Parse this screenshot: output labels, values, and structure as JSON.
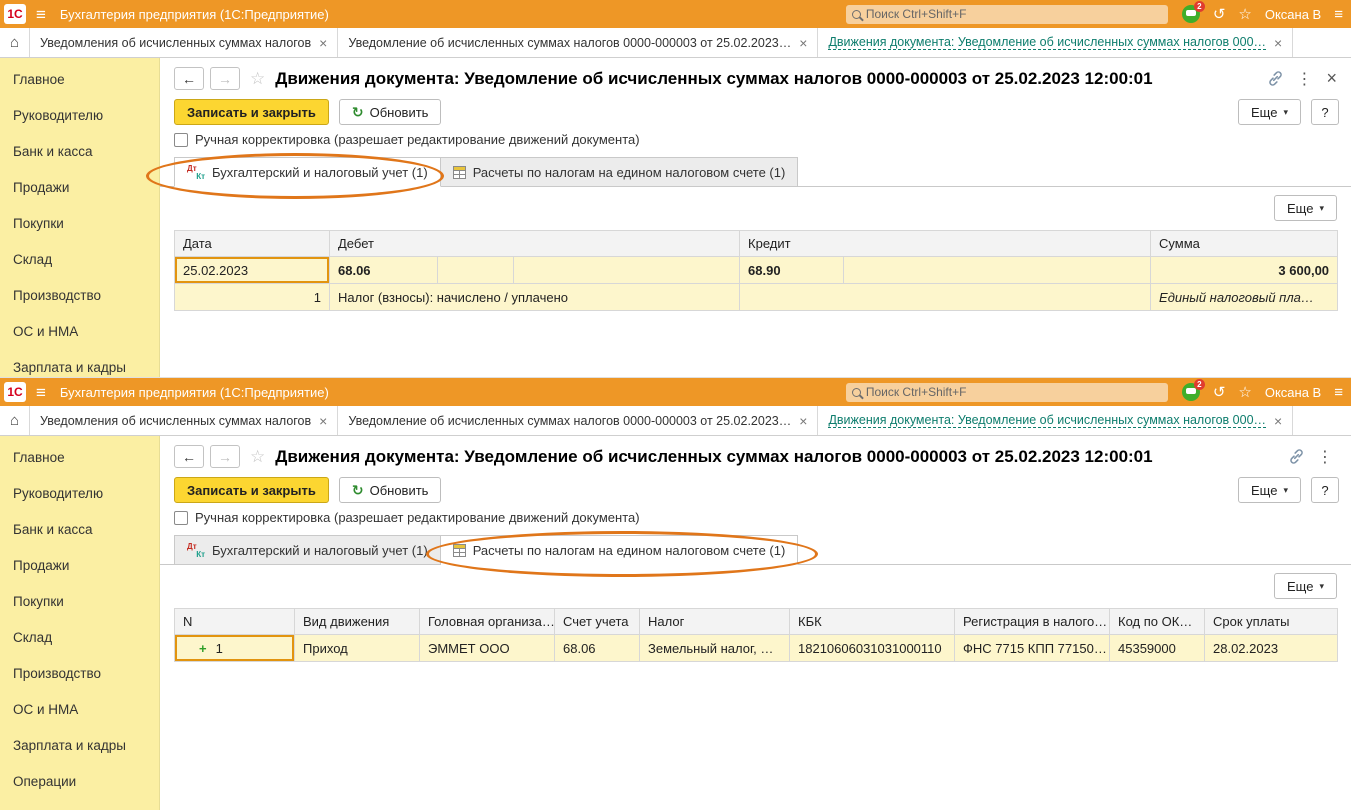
{
  "glyphs": {
    "home": "⌂",
    "close": "×",
    "back": "←",
    "forward": "→",
    "star": "☆",
    "refresh": "↻",
    "caret_down": "▾",
    "dots": "⋮",
    "history": "↺",
    "burger": "≡",
    "plus": "+",
    "dt": "Дт",
    "kt": "Кт"
  },
  "colors": {
    "titlebar_orange": "#EE9726",
    "sidebar_yellow": "#FBEFA3",
    "primary_button_yellow": "#FCD631",
    "active_tab_teal": "#0E7D6D",
    "selected_cell_amber": "#FFD159",
    "row_highlight_yellow": "#FDF6CC",
    "annotation_orange": "#E0761A"
  },
  "titlebar": {
    "logo_text": "1С",
    "app_title": "Бухгалтерия предприятия  (1С:Предприятие)",
    "search_placeholder": "Поиск Ctrl+Shift+F",
    "notification_badge": "2",
    "user_name": "Оксана В"
  },
  "tabstrip": {
    "tabs": [
      {
        "label": "Уведомления об исчисленных суммах налогов"
      },
      {
        "label": "Уведомление об исчисленных суммах налогов 0000-000003 от 25.02.2023…"
      },
      {
        "label": "Движения документа: Уведомление об исчисленных суммах налогов 000…"
      }
    ]
  },
  "sidebar": {
    "items": [
      "Главное",
      "Руководителю",
      "Банк и касса",
      "Продажи",
      "Покупки",
      "Склад",
      "Производство",
      "ОС и НМА",
      "Зарплата и кадры",
      "Операции"
    ]
  },
  "doc": {
    "title": "Движения документа: Уведомление об исчисленных суммах налогов 0000-000003 от 25.02.2023 12:00:01",
    "save_close": "Записать и закрыть",
    "refresh": "Обновить",
    "manual_correction": "Ручная корректировка (разрешает редактирование движений документа)",
    "more": "Еще",
    "help": "?",
    "tab_accounting": "Бухгалтерский и налоговый учет (1)",
    "tab_unified": "Расчеты по налогам на едином налоговом счете (1)"
  },
  "accounting_table": {
    "headers": {
      "date": "Дата",
      "debit": "Дебет",
      "credit": "Кредит",
      "sum": "Сумма"
    },
    "row1": {
      "date": "25.02.2023",
      "debit_account": "68.06",
      "credit_account": "68.90",
      "sum": "3 600,00"
    },
    "row2": {
      "line_no": "1",
      "analytics": "Налог (взносы): начислено / уплачено",
      "sum_note": "Единый налоговый пла…"
    }
  },
  "unified_table": {
    "headers": [
      "N",
      "Вид движения",
      "Головная организа…",
      "Счет учета",
      "Налог",
      "КБК",
      "Регистрация в налого…",
      "Код по ОК…",
      "Срок уплаты"
    ],
    "row": {
      "n": "1",
      "movement_type": "Приход",
      "organization": "ЭММЕТ ООО",
      "account": "68.06",
      "tax": "Земельный налог, …",
      "kbk": "18210606031031000110",
      "registration": "ФНС 7715 КПП 77150…",
      "oktmo": "45359000",
      "due_date": "28.02.2023"
    }
  }
}
